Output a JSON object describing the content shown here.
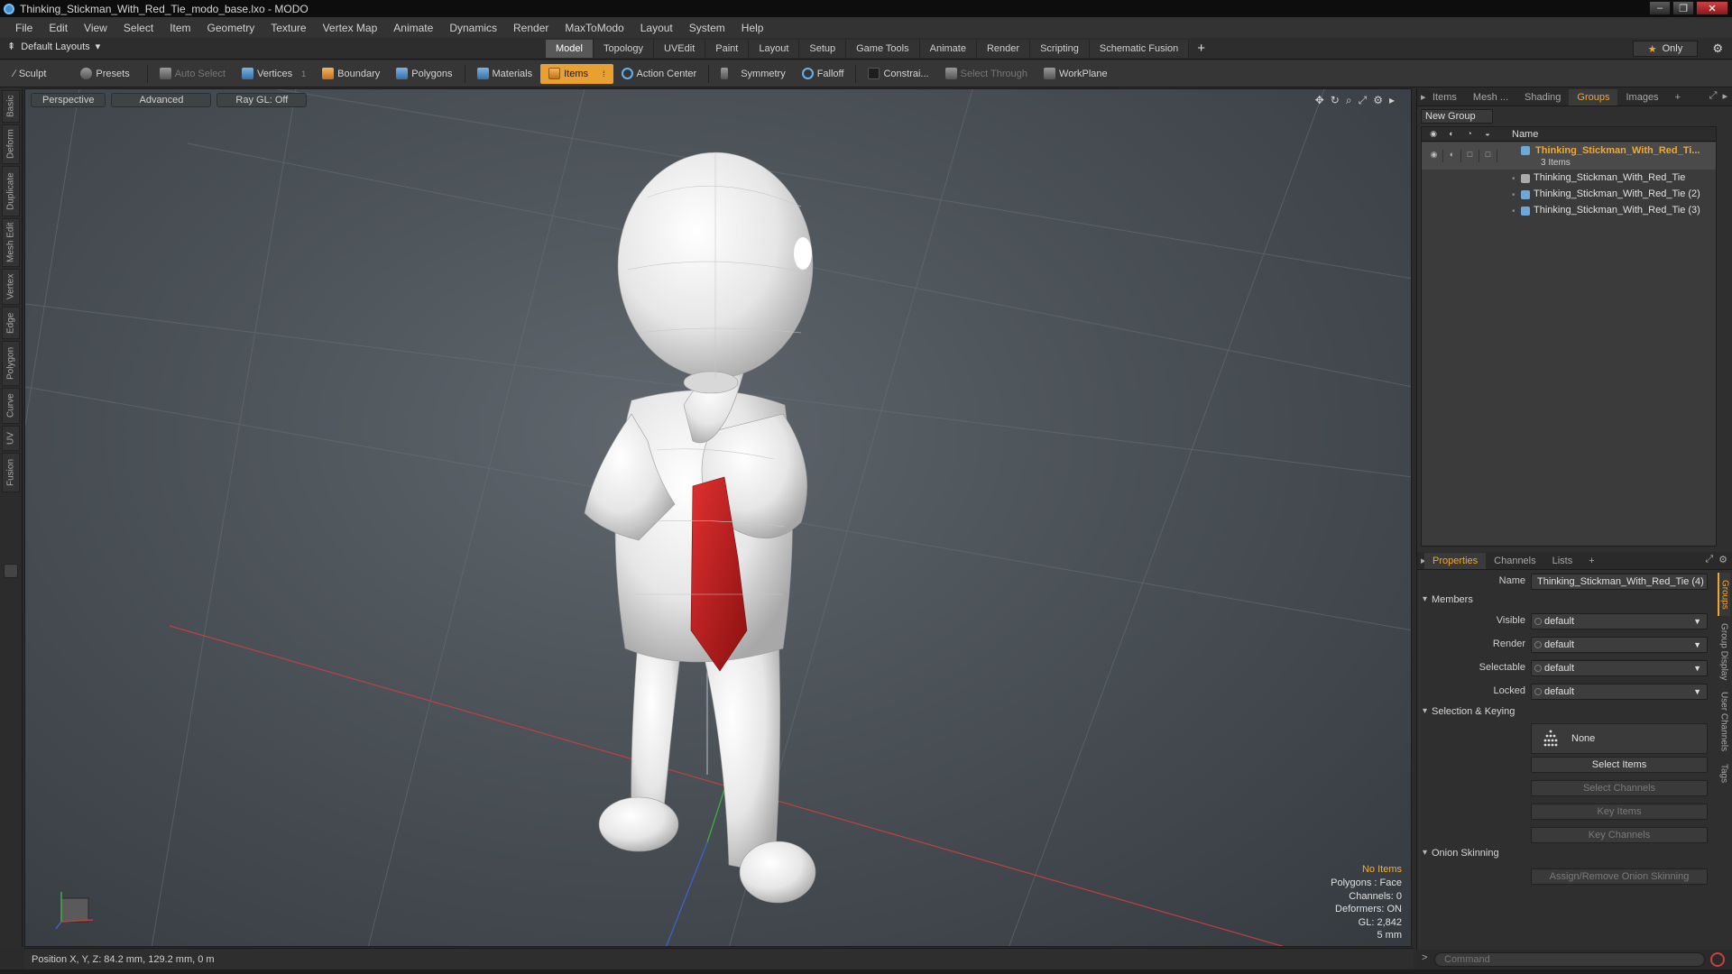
{
  "window": {
    "title": "Thinking_Stickman_With_Red_Tie_modo_base.lxo - MODO",
    "controls": [
      "–",
      "❐",
      "✕"
    ]
  },
  "menu": [
    "File",
    "Edit",
    "View",
    "Select",
    "Item",
    "Geometry",
    "Texture",
    "Vertex Map",
    "Animate",
    "Dynamics",
    "Render",
    "MaxToModo",
    "Layout",
    "System",
    "Help"
  ],
  "layoutbar": {
    "layouts_label": "Default Layouts",
    "tabs": [
      "Model",
      "Topology",
      "UVEdit",
      "Paint",
      "Layout",
      "Setup",
      "Game Tools",
      "Animate",
      "Render",
      "Scripting",
      "Schematic Fusion"
    ],
    "active_tab": "Model",
    "only_label": "Only"
  },
  "toolbar": {
    "sculpt": "Sculpt",
    "presets": "Presets",
    "auto_select": "Auto Select",
    "vertices": "Vertices",
    "vertices_count": "1",
    "boundary": "Boundary",
    "polygons": "Polygons",
    "materials": "Materials",
    "items": "Items",
    "action_center": "Action Center",
    "symmetry": "Symmetry",
    "falloff": "Falloff",
    "constraints": "Constrai...",
    "select_through": "Select Through",
    "workplane": "WorkPlane"
  },
  "left_tabs": [
    "Basic",
    "Deform",
    "Duplicate",
    "Mesh Edit",
    "Vertex",
    "Edge",
    "Polygon",
    "Curve",
    "UV",
    "Fusion"
  ],
  "viewport": {
    "view_mode": "Perspective",
    "shading": "Advanced",
    "raygl": "Ray GL: Off",
    "info": {
      "selection": "No Items",
      "polygons": "Polygons : Face",
      "channels": "Channels: 0",
      "deformers": "Deformers: ON",
      "gl": "GL: 2,842",
      "unit": "5 mm"
    },
    "colors": {
      "x_axis": "#c04040",
      "y_axis": "#40b040",
      "z_axis": "#4060d0",
      "tie": "#c42020"
    }
  },
  "status": {
    "position": "Position X, Y, Z:  84.2 mm, 129.2 mm, 0 m"
  },
  "right_panel": {
    "tabs": [
      "Items",
      "Mesh ...",
      "Shading",
      "Groups",
      "Images"
    ],
    "active_tab": "Groups",
    "new_group": "New Group",
    "list_header": "Name",
    "group": {
      "name": "Thinking_Stickman_With_Red_Ti...",
      "count": "3 Items",
      "children": [
        "Thinking_Stickman_With_Red_Tie",
        "Thinking_Stickman_With_Red_Tie (2)",
        "Thinking_Stickman_With_Red_Tie (3)"
      ]
    }
  },
  "properties": {
    "tabs": [
      "Properties",
      "Channels",
      "Lists"
    ],
    "active_tab": "Properties",
    "name_label": "Name",
    "name_value": "Thinking_Stickman_With_Red_Tie (4)",
    "members_section": "Members",
    "visible_label": "Visible",
    "visible_value": "default",
    "render_label": "Render",
    "render_value": "default",
    "selectable_label": "Selectable",
    "selectable_value": "default",
    "locked_label": "Locked",
    "locked_value": "default",
    "selection_section": "Selection & Keying",
    "none_label": "None",
    "select_items": "Select Items",
    "select_channels": "Select Channels",
    "key_items": "Key Items",
    "key_channels": "Key Channels",
    "onion_section": "Onion Skinning",
    "onion_button": "Assign/Remove Onion Skinning",
    "side_tabs": [
      "Groups",
      "Group Display",
      "User Channels",
      "Tags"
    ]
  },
  "command": {
    "placeholder": "Command"
  }
}
